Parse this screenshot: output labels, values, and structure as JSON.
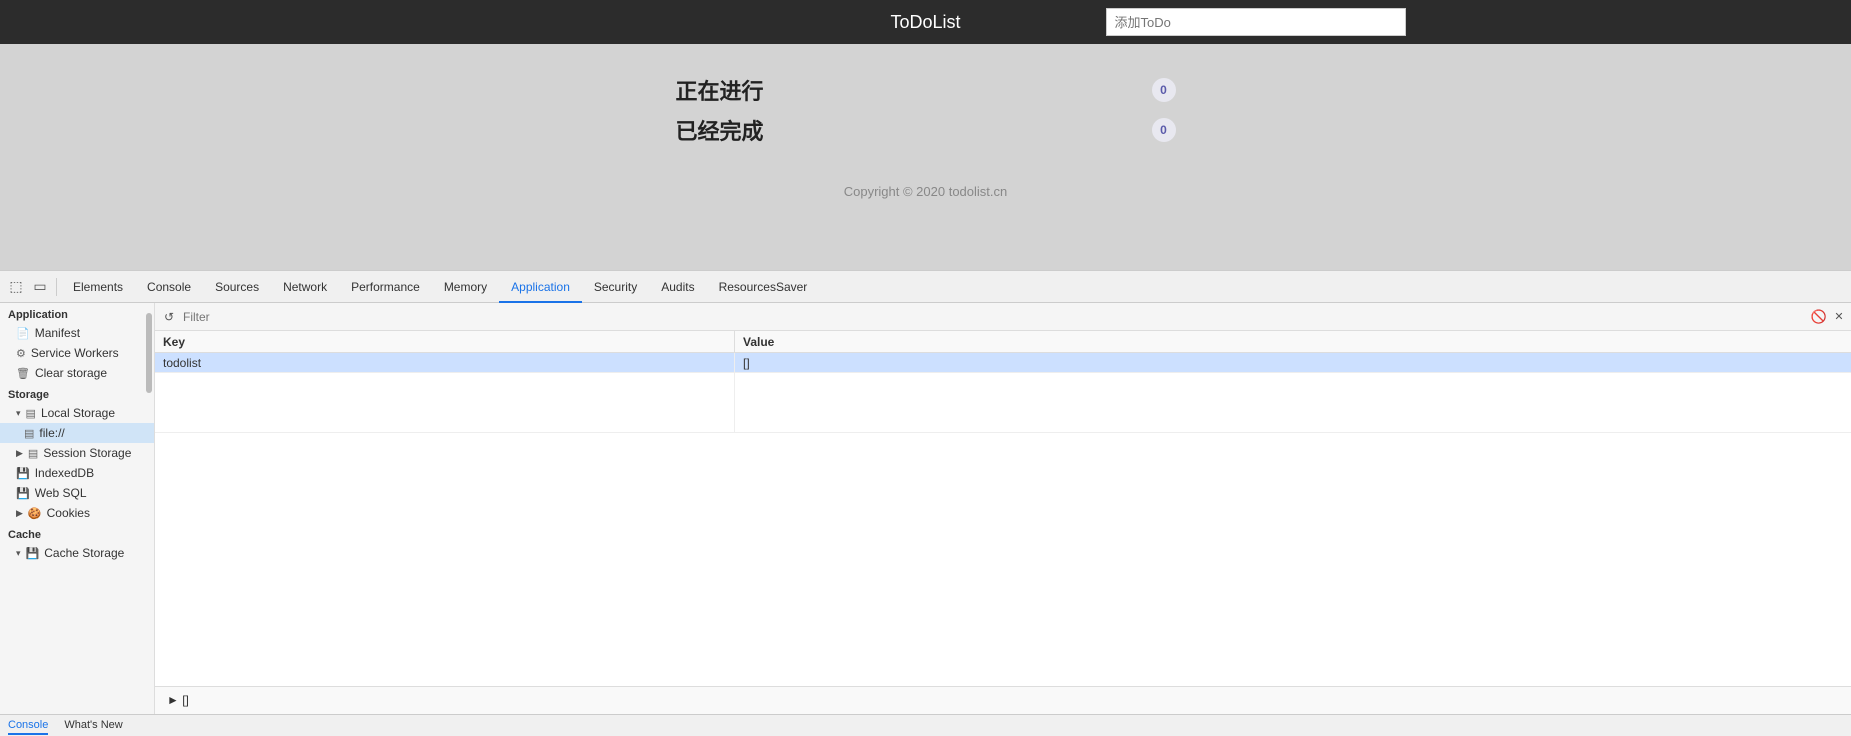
{
  "app": {
    "title": "ToDoList",
    "input_placeholder": "添加ToDo",
    "sections": [
      {
        "label": "正在进行",
        "count": "0"
      },
      {
        "label": "已经完成",
        "count": "0"
      }
    ],
    "copyright": "Copyright © 2020 todolist.cn"
  },
  "devtools": {
    "tabs": [
      {
        "id": "elements",
        "label": "Elements",
        "active": false
      },
      {
        "id": "console",
        "label": "Console",
        "active": false
      },
      {
        "id": "sources",
        "label": "Sources",
        "active": false
      },
      {
        "id": "network",
        "label": "Network",
        "active": false
      },
      {
        "id": "performance",
        "label": "Performance",
        "active": false
      },
      {
        "id": "memory",
        "label": "Memory",
        "active": false
      },
      {
        "id": "application",
        "label": "Application",
        "active": true
      },
      {
        "id": "security",
        "label": "Security",
        "active": false
      },
      {
        "id": "audits",
        "label": "Audits",
        "active": false
      },
      {
        "id": "resourcessaver",
        "label": "ResourcesSaver",
        "active": false
      }
    ],
    "sidebar": {
      "sections": [
        {
          "label": "Application",
          "items": [
            {
              "id": "manifest",
              "label": "Manifest",
              "icon": "📄",
              "indent": 0
            },
            {
              "id": "service-workers",
              "label": "Service Workers",
              "icon": "⚙",
              "indent": 0
            },
            {
              "id": "clear-storage",
              "label": "Clear storage",
              "icon": "🗑",
              "indent": 0
            }
          ]
        },
        {
          "label": "Storage",
          "items": [
            {
              "id": "local-storage",
              "label": "Local Storage",
              "icon": "▤",
              "indent": 0,
              "expanded": true,
              "arrow": "▾"
            },
            {
              "id": "file",
              "label": "file://",
              "icon": "▤",
              "indent": 1
            },
            {
              "id": "session-storage",
              "label": "Session Storage",
              "icon": "▤",
              "indent": 0,
              "arrow": "▶"
            },
            {
              "id": "indexeddb",
              "label": "IndexedDB",
              "icon": "💾",
              "indent": 0
            },
            {
              "id": "web-sql",
              "label": "Web SQL",
              "icon": "💾",
              "indent": 0
            },
            {
              "id": "cookies",
              "label": "Cookies",
              "icon": "🍪",
              "indent": 0,
              "arrow": "▶"
            }
          ]
        },
        {
          "label": "Cache",
          "items": [
            {
              "id": "cache-storage",
              "label": "Cache Storage",
              "icon": "💾",
              "indent": 0,
              "arrow": "▾"
            }
          ]
        }
      ]
    },
    "filter": {
      "placeholder": "Filter",
      "value": ""
    },
    "table": {
      "columns": [
        "Key",
        "Value"
      ],
      "rows": [
        {
          "key": "todolist",
          "value": "[]",
          "selected": true
        }
      ]
    },
    "value_preview": "► []"
  },
  "bottom_bar": {
    "tabs": [
      {
        "label": "Console",
        "active": true
      },
      {
        "label": "What's New",
        "active": false
      }
    ]
  },
  "icons": {
    "inspect": "⬚",
    "device": "▭",
    "refresh": "↺",
    "block": "🚫",
    "close": "✕"
  }
}
